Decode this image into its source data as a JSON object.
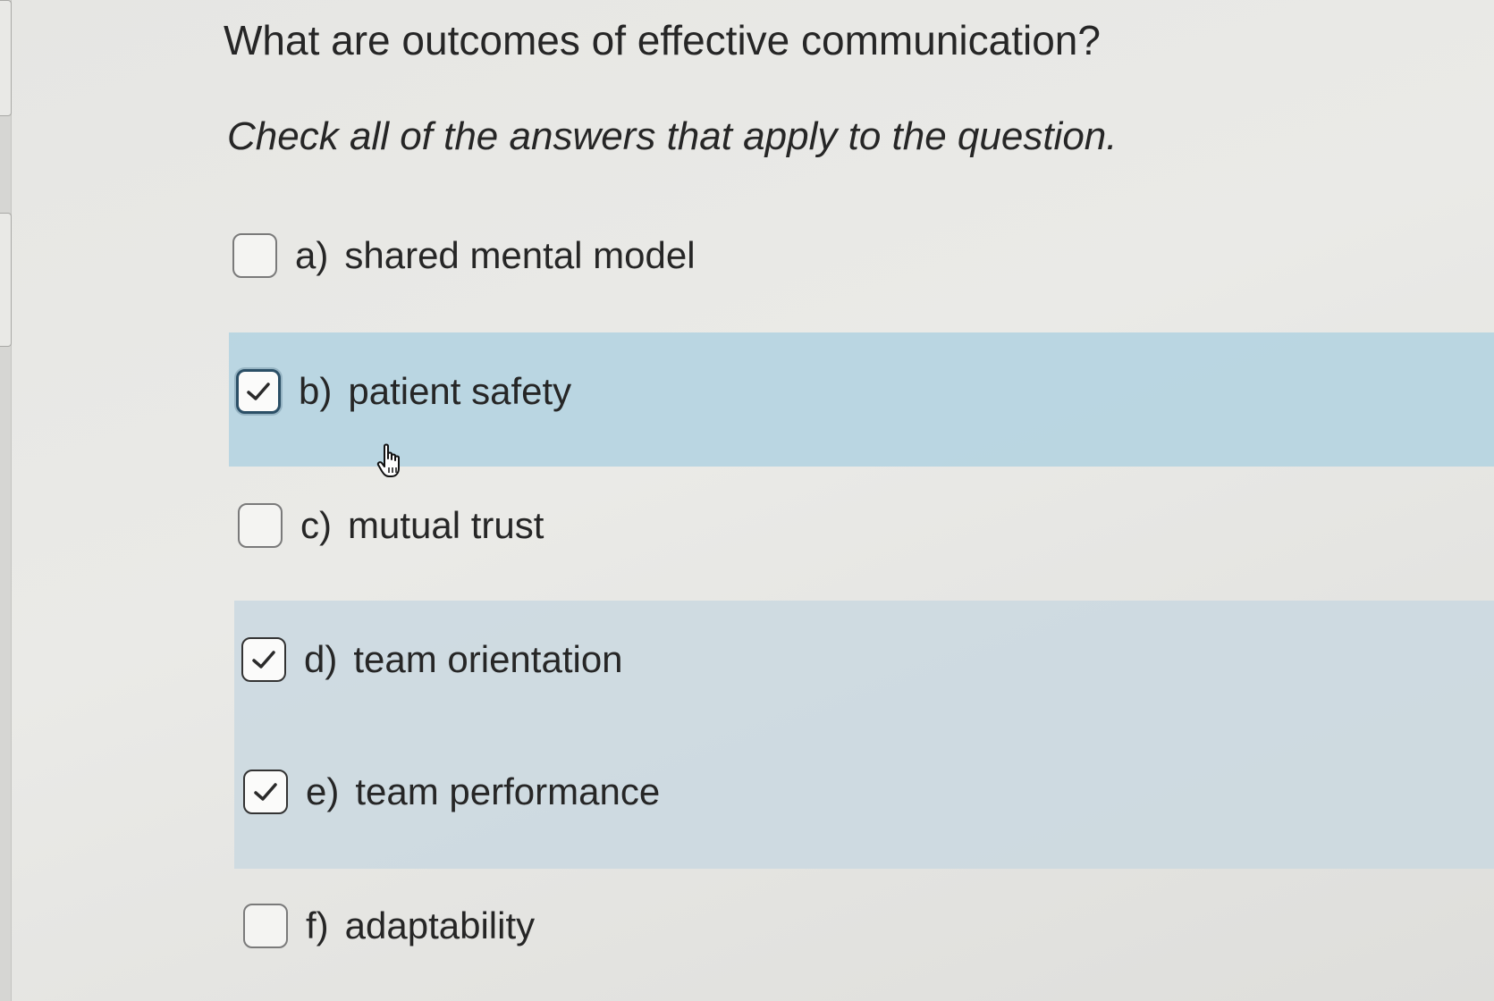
{
  "question": {
    "title": "What are outcomes of effective communication?",
    "instruction": "Check all of the answers that apply to the question."
  },
  "options": [
    {
      "letter": "a)",
      "text": "shared mental model",
      "checked": false
    },
    {
      "letter": "b)",
      "text": "patient safety",
      "checked": true
    },
    {
      "letter": "c)",
      "text": "mutual trust",
      "checked": false
    },
    {
      "letter": "d)",
      "text": "team orientation",
      "checked": true
    },
    {
      "letter": "e)",
      "text": "team performance",
      "checked": true
    },
    {
      "letter": "f)",
      "text": "adaptability",
      "checked": false
    }
  ],
  "colors": {
    "background": "#e8e8e5",
    "hover_highlight": "#b2d2e1",
    "selected_highlight": "#cad8e0",
    "focus_border": "#2b4f66",
    "text": "#262626"
  },
  "icons": {
    "checkmark": "checkmark-icon",
    "pointer": "hand-pointer-icon"
  }
}
